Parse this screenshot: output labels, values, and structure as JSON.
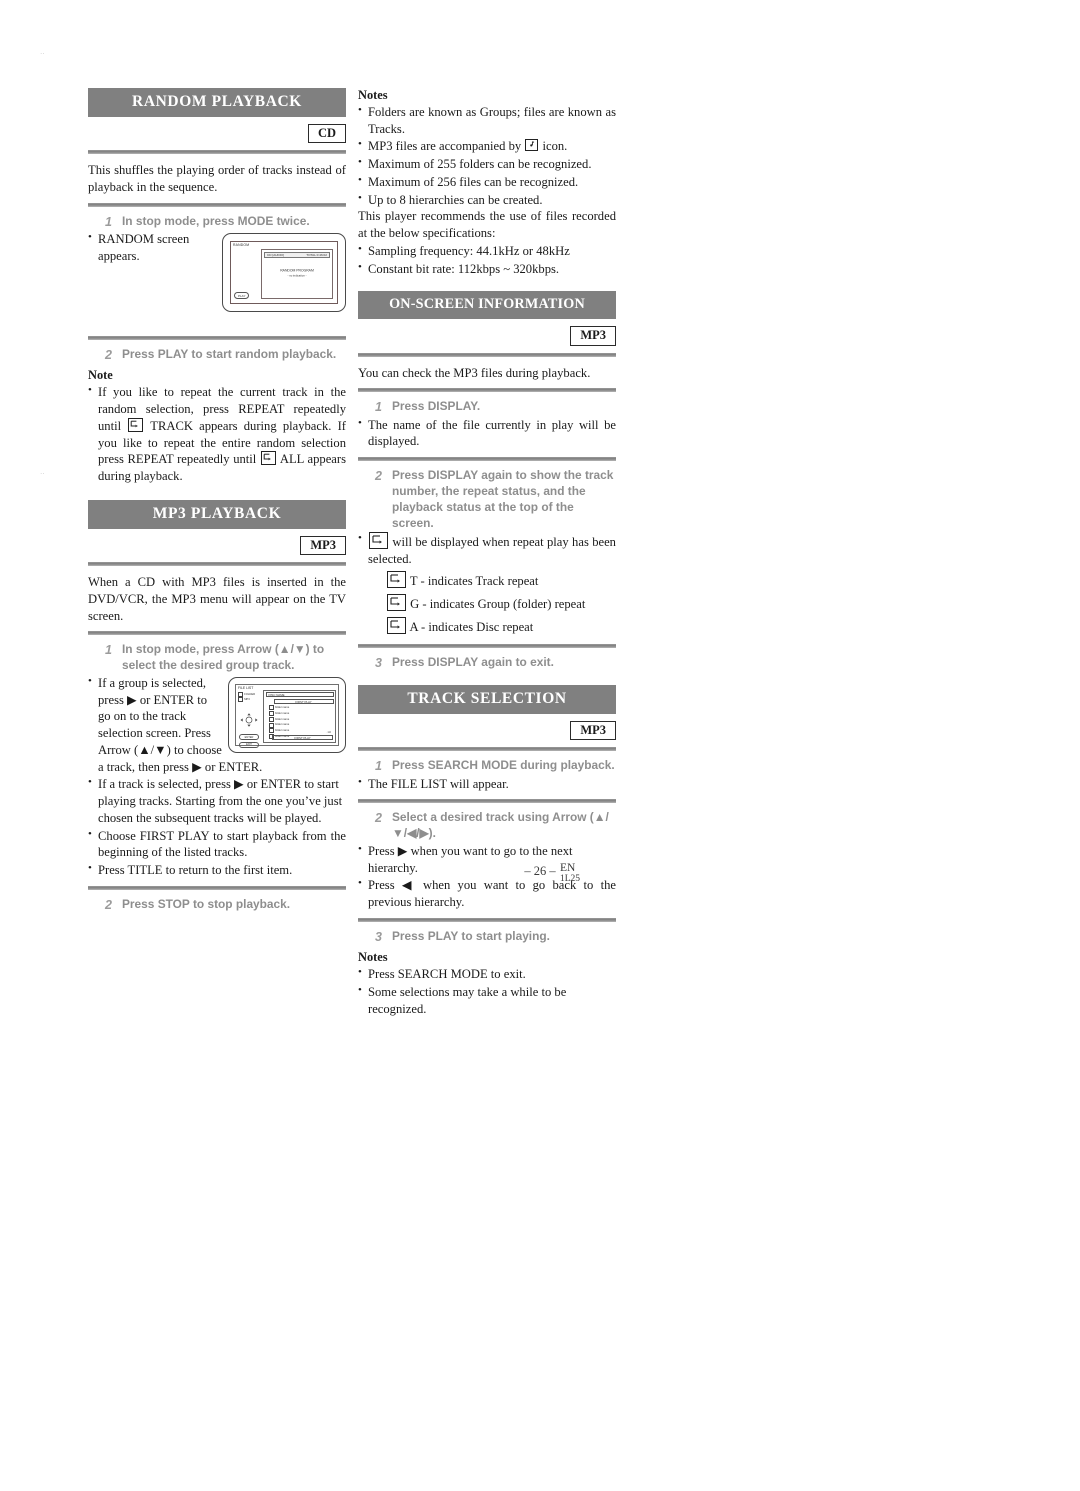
{
  "page": {
    "number": "– 26 –",
    "lang_code": "EN",
    "doc_code": "1L25",
    "corner_mark": "··"
  },
  "sections": {
    "random_playback": {
      "title": "RANDOM PLAYBACK",
      "badge": "CD",
      "intro": "This shuffles the playing order of tracks instead of playback in the sequence.",
      "step1": {
        "num": "1",
        "text": "In stop mode, press MODE twice."
      },
      "step1_bullet": "RANDOM screen appears.",
      "step2": {
        "num": "2",
        "text": "Press PLAY to start random playback."
      },
      "note_heading": "Note",
      "note_part1": "If you like to repeat the current track in the random selection, press REPEAT repeatedly until",
      "note_part2": "TRACK appears during playback. If you like to repeat the entire random selection press REPEAT repeatedly until",
      "note_part3": "ALL appears during playback.",
      "tv_screen": {
        "label": "RANDOM",
        "bar_left": "CD [AUDIO]",
        "bar_right": "TOTAL 0:46:02",
        "center_line1": "RANDOM PROGRAM",
        "center_line2": "- no indication -",
        "button": "PLAY"
      }
    },
    "mp3_playback": {
      "title": "MP3 PLAYBACK",
      "badge": "MP3",
      "intro": "When a CD with MP3 files is inserted in the DVD/VCR, the MP3 menu will appear on the TV screen.",
      "step1": {
        "num": "1",
        "text": "In stop mode, press Arrow (▲/▼) to select the desired group track."
      },
      "bullets": [
        "If a group is selected, press ▶ or ENTER to go on to the track selection screen. Press Arrow (▲/▼) to choose a track, then press ▶ or ENTER.",
        "If a track is selected, press ▶ or ENTER to start playing tracks. Starting from the one you’ve just chosen the subsequent tracks will be played.",
        "Choose FIRST PLAY to start playback from the beginning of the listed tracks.",
        "Press TITLE to return to the first item."
      ],
      "step2": {
        "num": "2",
        "text": "Press STOP to stop playback."
      },
      "file_list_screen": {
        "title": "FILE LIST",
        "legend_folder": "FOLDER",
        "legend_mp3": "MP3",
        "disc_name": "DISC NAME",
        "first_play_top": "FIRST PLAY",
        "rows": [
          "folder name",
          "folder name",
          "folder name",
          "folder name",
          "folder name",
          "folder name"
        ],
        "scroll_hint": "·1/2",
        "first_play_bottom": "FIRST PLAY",
        "btn_enter": "ENTER",
        "btn_exit": "EXIT"
      }
    },
    "notes_mp3": {
      "heading": "Notes",
      "bullets_before": [
        "Folders are known as Groups; files are known as Tracks."
      ],
      "bullet_icon_pre": "MP3 files are accompanied by",
      "bullet_icon_post": "icon.",
      "bullets_after": [
        "Maximum of 255 folders can be recognized.",
        "Maximum of 256 files can be recognized.",
        "Up to 8 hierarchies can be created."
      ],
      "recommend": "This player recommends the use of files recorded at the below specifications:",
      "specs": [
        "Sampling frequency: 44.1kHz or 48kHz",
        "Constant bit rate: 112kbps ~ 320kbps."
      ]
    },
    "on_screen_information": {
      "title": "ON-SCREEN INFORMATION",
      "badge": "MP3",
      "intro": "You can check the MP3 files during playback.",
      "step1": {
        "num": "1",
        "text": "Press DISPLAY."
      },
      "step1_bullet": "The name of the file currently in play will be displayed.",
      "step2": {
        "num": "2",
        "text": "Press DISPLAY again to show the track number, the repeat status, and the playback status at the top of the screen."
      },
      "repeat_bullet": "will be displayed when repeat play has been selected.",
      "indicators": [
        "T - indicates Track repeat",
        "G - indicates Group (folder) repeat",
        "A - indicates Disc repeat"
      ],
      "step3": {
        "num": "3",
        "text": "Press DISPLAY again to exit."
      }
    },
    "track_selection": {
      "title": "TRACK SELECTION",
      "badge": "MP3",
      "step1": {
        "num": "1",
        "text": "Press SEARCH MODE during playback."
      },
      "step1_bullet": "The FILE LIST will appear.",
      "step2": {
        "num": "2",
        "text": "Select a desired track using Arrow (▲/▼/◀/▶)."
      },
      "step2_bullets": [
        "Press ▶ when you want to go to the next hierarchy.",
        "Press ◀ when you want to go back to the previous hierarchy."
      ],
      "step3": {
        "num": "3",
        "text": "Press PLAY to start playing."
      },
      "notes_heading": "Notes",
      "notes": [
        "Press SEARCH MODE to exit.",
        "Some selections may take a while to be recognized."
      ]
    }
  }
}
